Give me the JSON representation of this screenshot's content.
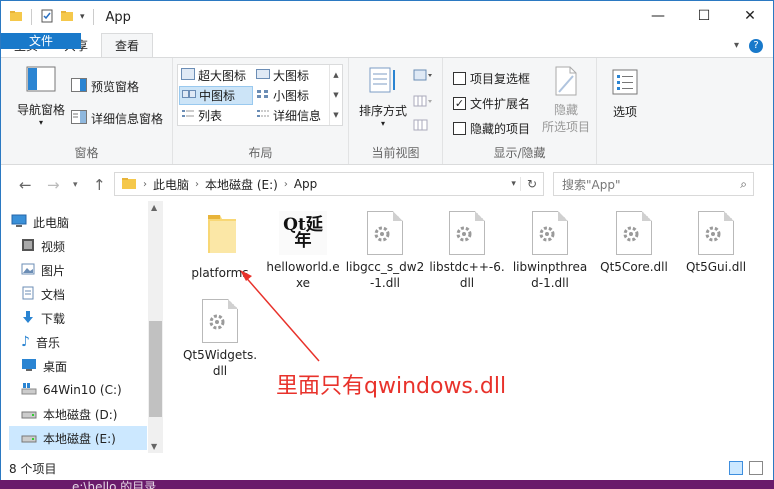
{
  "window": {
    "title": "App",
    "controls": {
      "minimize": "—",
      "maximize": "☐",
      "close": "✕"
    }
  },
  "ribbon": {
    "tabs": [
      "文件",
      "主页",
      "共享",
      "查看"
    ],
    "active_tab": "查看",
    "panes": {
      "label": "窗格",
      "nav_pane": "导航窗格",
      "preview_pane": "预览窗格",
      "details_pane": "详细信息窗格"
    },
    "layout": {
      "label": "布局",
      "items": [
        "超大图标",
        "大图标",
        "中图标",
        "小图标",
        "列表",
        "详细信息"
      ],
      "selected": "中图标"
    },
    "current_view": {
      "label": "当前视图",
      "sort_by": "排序方式"
    },
    "show_hide": {
      "label": "显示/隐藏",
      "item_checkboxes": "项目复选框",
      "file_extensions": "文件扩展名",
      "hidden_items": "隐藏的项目",
      "hide": "隐藏",
      "hide_selected": "所选项目",
      "checked": {
        "item_checkboxes": false,
        "file_extensions": true,
        "hidden_items": false
      }
    },
    "options": "选项"
  },
  "address": {
    "crumbs": [
      "此电脑",
      "本地磁盘 (E:)",
      "App"
    ],
    "search_placeholder": "搜索\"App\""
  },
  "nav_pane": {
    "items": [
      {
        "label": "此电脑",
        "icon": "computer-icon"
      },
      {
        "label": "视频",
        "icon": "video-icon"
      },
      {
        "label": "图片",
        "icon": "pictures-icon"
      },
      {
        "label": "文档",
        "icon": "documents-icon"
      },
      {
        "label": "下载",
        "icon": "download-icon"
      },
      {
        "label": "音乐",
        "icon": "music-icon"
      },
      {
        "label": "桌面",
        "icon": "desktop-icon"
      },
      {
        "label": "64Win10 (C:)",
        "icon": "drive-icon"
      },
      {
        "label": "本地磁盘 (D:)",
        "icon": "drive-icon"
      },
      {
        "label": "本地磁盘 (E:)",
        "icon": "drive-icon"
      }
    ],
    "selected": "本地磁盘 (E:)"
  },
  "files": [
    {
      "name": "platforms",
      "type": "folder"
    },
    {
      "name": "helloworld.exe",
      "type": "exe"
    },
    {
      "name": "libgcc_s_dw2-1.dll",
      "type": "dll"
    },
    {
      "name": "libstdc++-6.dll",
      "type": "dll"
    },
    {
      "name": "libwinpthread-1.dll",
      "type": "dll"
    },
    {
      "name": "Qt5Core.dll",
      "type": "dll"
    },
    {
      "name": "Qt5Gui.dll",
      "type": "dll"
    },
    {
      "name": "Qt5Widgets.dll",
      "type": "dll"
    }
  ],
  "exe_icon_text": "Qt延年",
  "annotation": "里面只有qwindows.dll",
  "status": {
    "item_count": "8 个项目"
  },
  "behind_text": "e:\\hello 的目录",
  "colors": {
    "accent": "#1979ca",
    "annotation": "#e8322b",
    "selection": "#cce8ff"
  }
}
